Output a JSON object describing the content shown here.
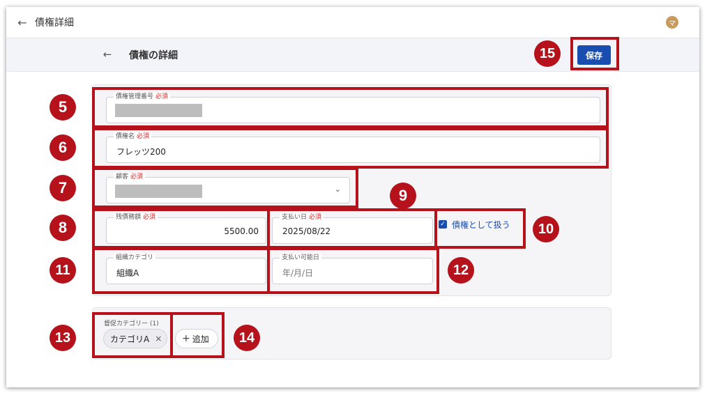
{
  "app": {
    "title": "債権詳細",
    "avatar_initial": "マ"
  },
  "subheader": {
    "title": "債権の詳細",
    "save_label": "保存"
  },
  "required_label": "必須",
  "form": {
    "management_number": {
      "label": "債権管理番号",
      "value": ""
    },
    "name": {
      "label": "債権名",
      "value": "フレッツ200"
    },
    "customer": {
      "label": "顧客",
      "value": ""
    },
    "remaining_amount": {
      "label": "残債務額",
      "value": "5500.00"
    },
    "payment_date": {
      "label": "支払い日",
      "value": "2025/08/22"
    },
    "treat_as_claim": {
      "label": "債権として扱う",
      "checked": true
    },
    "org_category": {
      "label": "組織カテゴリ",
      "value": "組織A"
    },
    "payable_date": {
      "label": "支払い可能日",
      "placeholder": "年/月/日"
    }
  },
  "promotion": {
    "label": "督促カテゴリー (1)",
    "chips": [
      {
        "label": "カテゴリA"
      }
    ],
    "add_label": "追加"
  },
  "annotations": [
    "5",
    "6",
    "7",
    "8",
    "9",
    "10",
    "11",
    "12",
    "13",
    "14",
    "15"
  ],
  "colors": {
    "accent": "#1a4db0",
    "highlight": "#b5121b",
    "required": "#dd2222"
  }
}
